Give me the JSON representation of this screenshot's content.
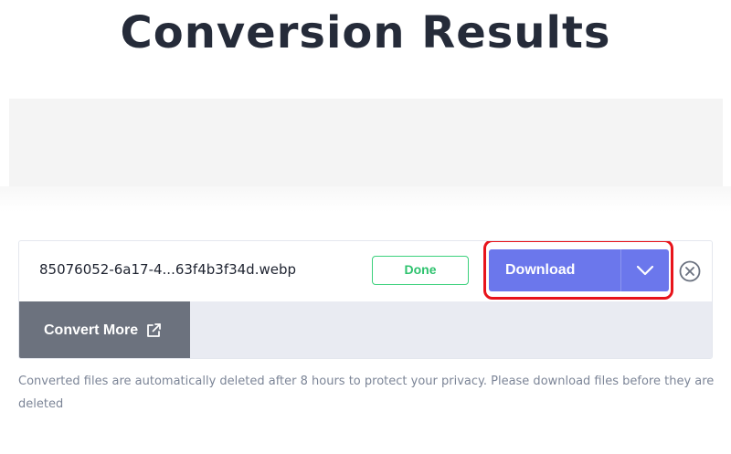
{
  "header": {
    "title": "Conversion Results"
  },
  "result": {
    "file_name": "85076052-6a17-4...63f4b3f34d.webp",
    "status": "Done",
    "download_label": "Download",
    "convert_more_label": "Convert More"
  },
  "footer": {
    "privacy_note": "Converted files are automatically deleted after 8 hours to protect your privacy. Please download files before they are deleted"
  },
  "icons": {
    "dropdown": "chevron-down-icon",
    "remove": "close-circle-icon",
    "external": "external-link-icon"
  },
  "colors": {
    "download": "#6b77ec",
    "done": "#3bd17c",
    "highlight": "#e8141b",
    "convert_more": "#6c727e"
  }
}
